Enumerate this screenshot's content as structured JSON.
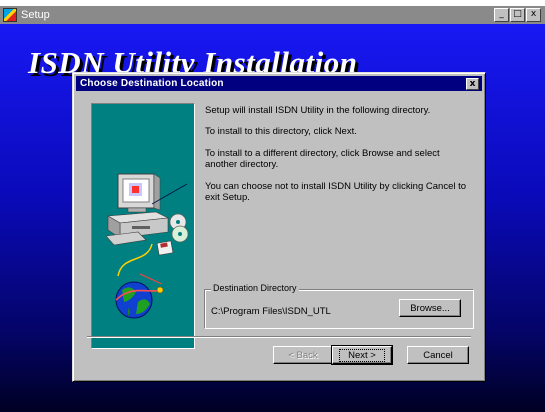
{
  "window": {
    "title": "Setup",
    "buttons": [
      "_",
      "□",
      "x"
    ]
  },
  "background": {
    "title": "ISDN Utility Installation"
  },
  "dialog": {
    "title": "Choose Destination Location",
    "close_label": "x",
    "messages": [
      "Setup will install ISDN Utility in the following directory.",
      "To install to this directory, click Next.",
      "To install to a different directory, click Browse and select another directory.",
      "You can choose not to install ISDN Utility by clicking Cancel to exit Setup."
    ],
    "destination": {
      "legend": "Destination Directory",
      "path": "C:\\Program Files\\ISDN_UTL",
      "browse_label": "Browse..."
    },
    "buttons": {
      "back": "< Back",
      "next": "Next >",
      "cancel": "Cancel"
    }
  },
  "colors": {
    "dialog_title_bg": "#000080",
    "panel_teal": "#008080",
    "background_blue": "#1818f4"
  },
  "icons": [
    "setup-app-icon",
    "computer-icon",
    "cd-disc-icon",
    "floppy-disk-icon",
    "globe-icon"
  ]
}
